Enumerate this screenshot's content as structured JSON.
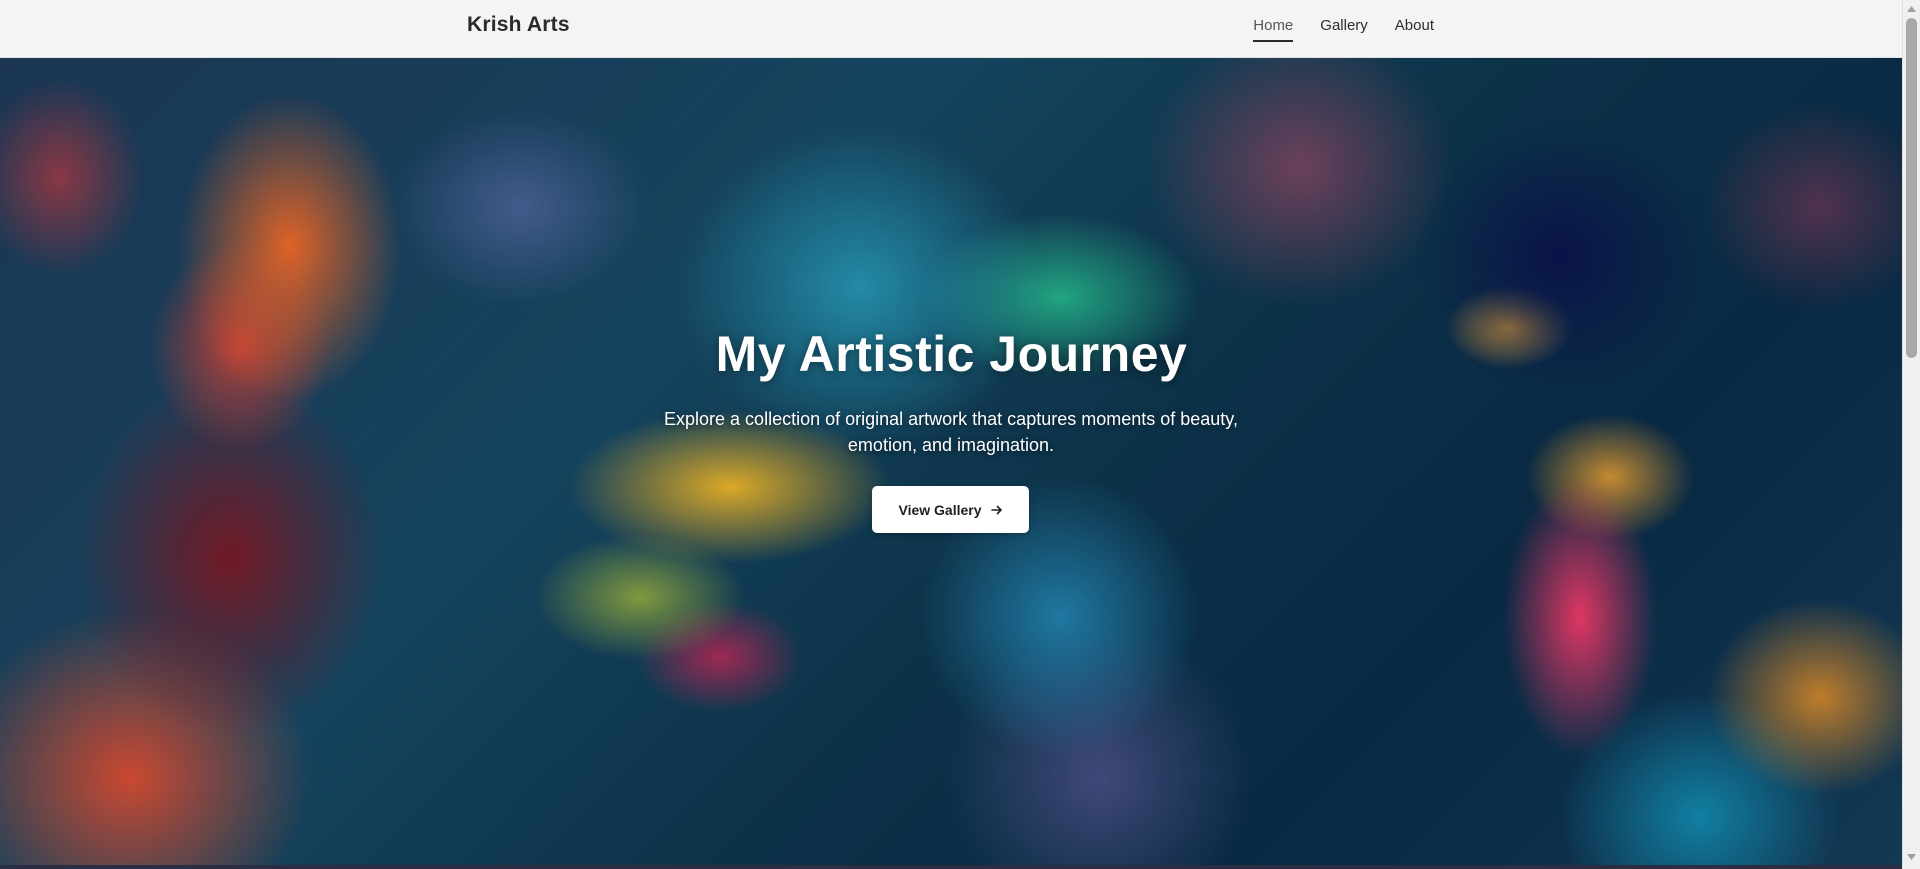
{
  "header": {
    "brand": "Krish Arts",
    "nav": [
      {
        "label": "Home",
        "active": true
      },
      {
        "label": "Gallery",
        "active": false
      },
      {
        "label": "About",
        "active": false
      }
    ]
  },
  "hero": {
    "title": "My Artistic Journey",
    "subtitle": "Explore a collection of original artwork that captures moments of beauty, emotion, and imagination.",
    "button_label": "View Gallery",
    "button_icon": "arrow-right-icon"
  },
  "colors": {
    "header_bg": "#f4f4f4",
    "button_bg": "#ffffff",
    "text_light": "#ffffff",
    "text_dark": "#2a2a2a"
  }
}
